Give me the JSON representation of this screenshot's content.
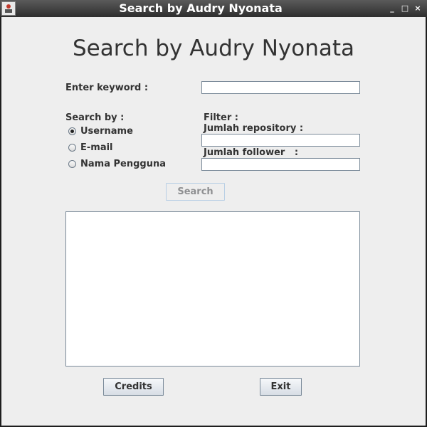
{
  "window": {
    "title": "Search by Audry Nyonata",
    "controls": {
      "minimize": "_",
      "maximize": "□",
      "close": "×"
    }
  },
  "heading": "Search by Audry Nyonata",
  "keyword": {
    "label": "Enter keyword :",
    "value": ""
  },
  "search_by": {
    "label": "Search by :",
    "options": [
      {
        "label": "Username",
        "selected": true
      },
      {
        "label": "E-mail",
        "selected": false
      },
      {
        "label": "Nama Pengguna",
        "selected": false
      }
    ]
  },
  "filter": {
    "label": "Filter :",
    "repository_label": "Jumlah repository :",
    "repository_value": "",
    "follower_label": "Jumlah follower   :",
    "follower_value": ""
  },
  "buttons": {
    "search": "Search",
    "credits": "Credits",
    "exit": "Exit"
  },
  "results": {
    "text": ""
  }
}
